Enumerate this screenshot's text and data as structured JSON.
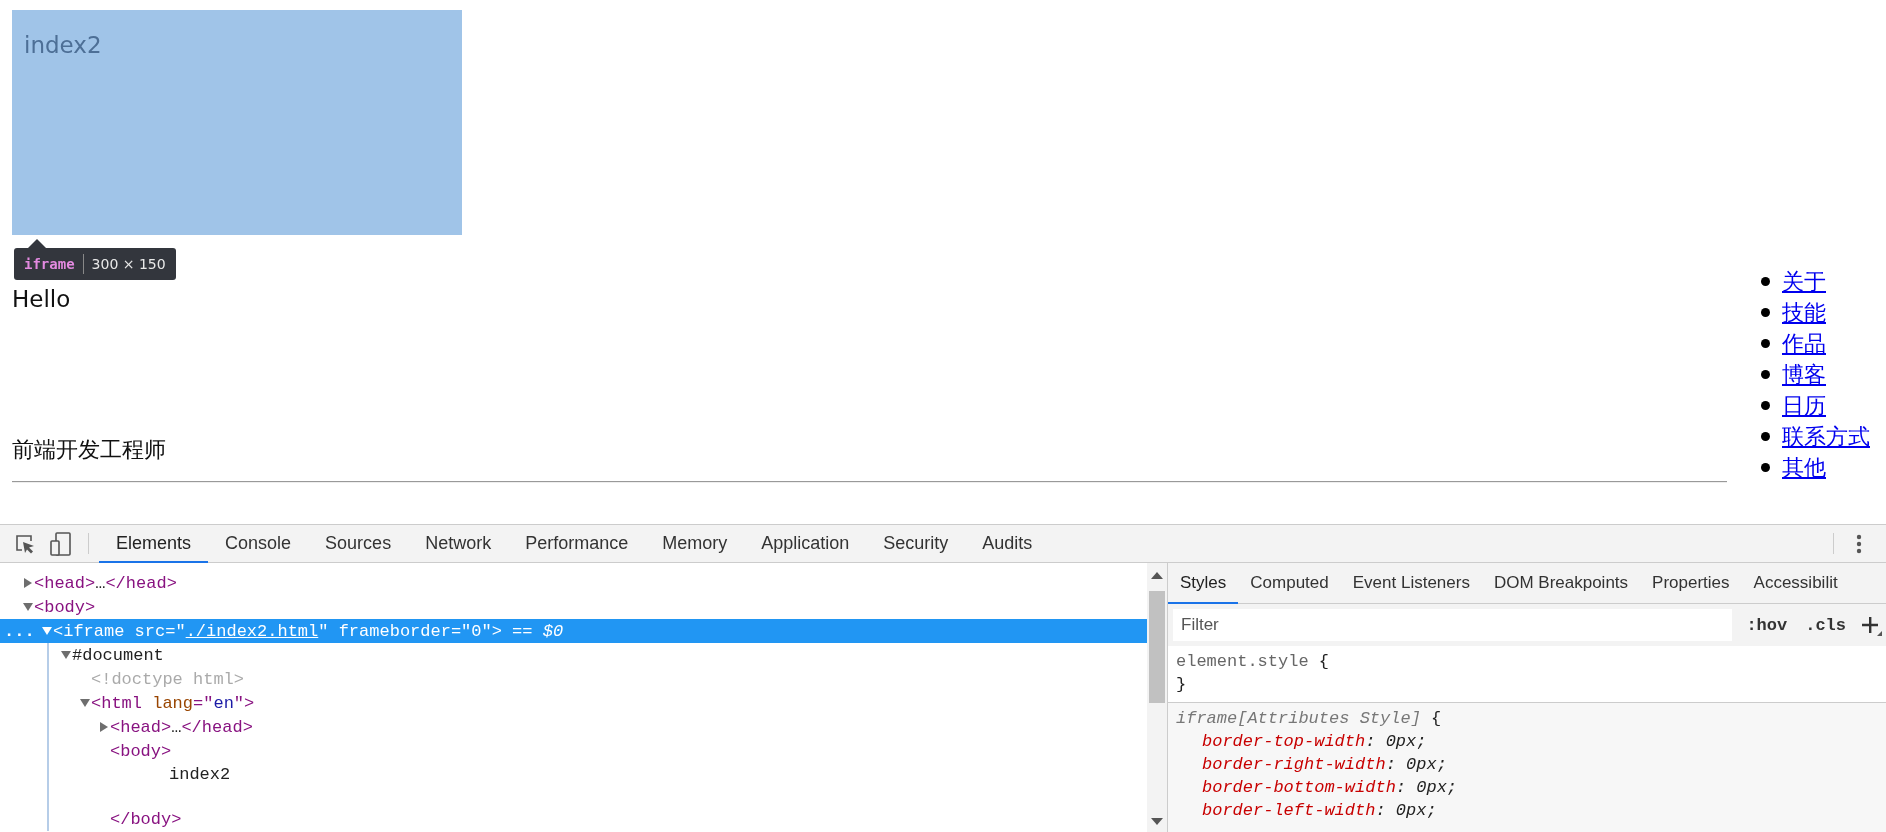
{
  "page": {
    "frame": {
      "text": "index2"
    },
    "tooltip": {
      "tag": "iframe",
      "size": "300 × 150"
    },
    "greeting": "Hello",
    "title": "前端开发工程师",
    "nav": [
      {
        "label": "关于"
      },
      {
        "label": "技能"
      },
      {
        "label": "作品"
      },
      {
        "label": "博客"
      },
      {
        "label": "日历"
      },
      {
        "label": "联系方式"
      },
      {
        "label": "其他"
      }
    ]
  },
  "devtools": {
    "tabs": [
      {
        "label": "Elements",
        "selected": true
      },
      {
        "label": "Console",
        "selected": false
      },
      {
        "label": "Sources",
        "selected": false
      },
      {
        "label": "Network",
        "selected": false
      },
      {
        "label": "Performance",
        "selected": false
      },
      {
        "label": "Memory",
        "selected": false
      },
      {
        "label": "Application",
        "selected": false
      },
      {
        "label": "Security",
        "selected": false
      },
      {
        "label": "Audits",
        "selected": false
      }
    ],
    "dom_tree": [
      {
        "expanded": false,
        "selected": false,
        "tokens": [
          {
            "kind": "tag",
            "text": "<head>"
          },
          {
            "kind": "plain",
            "text": "…"
          },
          {
            "kind": "tag",
            "text": "</head>"
          }
        ]
      },
      {
        "expanded": true,
        "selected": false,
        "tokens": [
          {
            "kind": "tag",
            "text": "<body>"
          }
        ],
        "children": [
          {
            "expanded": true,
            "selected": true,
            "gutter": "...",
            "tokens": [
              {
                "kind": "tag",
                "text": "<iframe"
              },
              {
                "kind": "attr",
                "text": " src"
              },
              {
                "kind": "tag",
                "text": "=\""
              },
              {
                "kind": "link",
                "text": "./index2.html"
              },
              {
                "kind": "tag",
                "text": "\""
              },
              {
                "kind": "attr",
                "text": " frameborder"
              },
              {
                "kind": "tag",
                "text": "=\""
              },
              {
                "kind": "value",
                "text": "0"
              },
              {
                "kind": "tag",
                "text": "\">"
              },
              {
                "kind": "marker",
                "text": " == $0"
              }
            ],
            "children": [
              {
                "expanded": true,
                "selected": false,
                "tokens": [
                  {
                    "kind": "plain",
                    "text": "#document"
                  }
                ],
                "children": [
                  {
                    "selected": false,
                    "tokens": [
                      {
                        "kind": "comment",
                        "text": "<!doctype html>"
                      }
                    ]
                  },
                  {
                    "expanded": true,
                    "selected": false,
                    "tokens": [
                      {
                        "kind": "tag",
                        "text": "<html"
                      },
                      {
                        "kind": "attr",
                        "text": " lang"
                      },
                      {
                        "kind": "tag",
                        "text": "=\""
                      },
                      {
                        "kind": "value",
                        "text": "en"
                      },
                      {
                        "kind": "tag",
                        "text": "\">"
                      }
                    ],
                    "children": [
                      {
                        "expanded": false,
                        "selected": false,
                        "tokens": [
                          {
                            "kind": "tag",
                            "text": "<head>"
                          },
                          {
                            "kind": "plain",
                            "text": "…"
                          },
                          {
                            "kind": "tag",
                            "text": "</head>"
                          }
                        ]
                      },
                      {
                        "selected": false,
                        "tokens": [
                          {
                            "kind": "tag",
                            "text": "<body>"
                          }
                        ],
                        "children": [
                          {
                            "selected": false,
                            "kind": "text",
                            "tokens": [
                              {
                                "kind": "plain",
                                "text": "index2"
                              }
                            ]
                          }
                        ],
                        "closing": [
                          {
                            "kind": "tag",
                            "text": "</body>"
                          }
                        ]
                      }
                    ]
                  }
                ]
              }
            ]
          }
        ]
      }
    ],
    "styles_tabs": [
      {
        "label": "Styles",
        "selected": true
      },
      {
        "label": "Computed",
        "selected": false
      },
      {
        "label": "Event Listeners",
        "selected": false
      },
      {
        "label": "DOM Breakpoints",
        "selected": false
      },
      {
        "label": "Properties",
        "selected": false
      },
      {
        "label": "Accessibilit",
        "selected": false
      }
    ],
    "filter": {
      "placeholder": "Filter"
    },
    "filter_buttons": [
      ":hov",
      ".cls"
    ],
    "rules": [
      {
        "kind": "inline",
        "selector": "element.style",
        "open": " {",
        "close": "}"
      },
      {
        "kind": "attributes",
        "selector": "iframe[Attributes Style]",
        "open": " {",
        "declarations": [
          {
            "property": "border-top-width",
            "value": ": 0px;"
          },
          {
            "property": "border-right-width",
            "value": ": 0px;"
          },
          {
            "property": "border-bottom-width",
            "value": ": 0px;"
          },
          {
            "property": "border-left-width",
            "value": ": 0px;"
          }
        ]
      }
    ]
  }
}
